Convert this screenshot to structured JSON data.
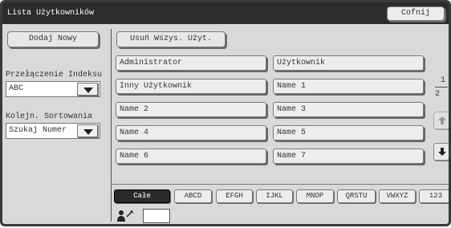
{
  "window": {
    "title": "Lista Użytkowników",
    "back_label": "Cofnij"
  },
  "left": {
    "add_new_label": "Dodaj Nowy",
    "index_switch_label": "Przełączenie Indeksu",
    "index_switch_value": "ABC",
    "sort_order_label": "Kolejn. Sortowania",
    "sort_order_value": "Szukaj Numer"
  },
  "main": {
    "delete_all_label": "Usuń Wszys. Użyt.",
    "users": [
      "Administrator",
      "Użytkownik",
      "Inny Użytkownik",
      "Name 1",
      "Name 2",
      "Name 3",
      "Name 4",
      "Name 5",
      "Name 6",
      "Name 7"
    ],
    "pages": [
      "1",
      "2"
    ],
    "index_tabs": [
      "Całe",
      "ABCD",
      "EFGH",
      "IJKL",
      "MNOP",
      "QRSTU",
      "VWXYZ",
      "123"
    ]
  },
  "icons": {
    "scroll_up": "arrow-up-icon",
    "scroll_down": "arrow-down-icon",
    "user": "person-edit-icon"
  }
}
